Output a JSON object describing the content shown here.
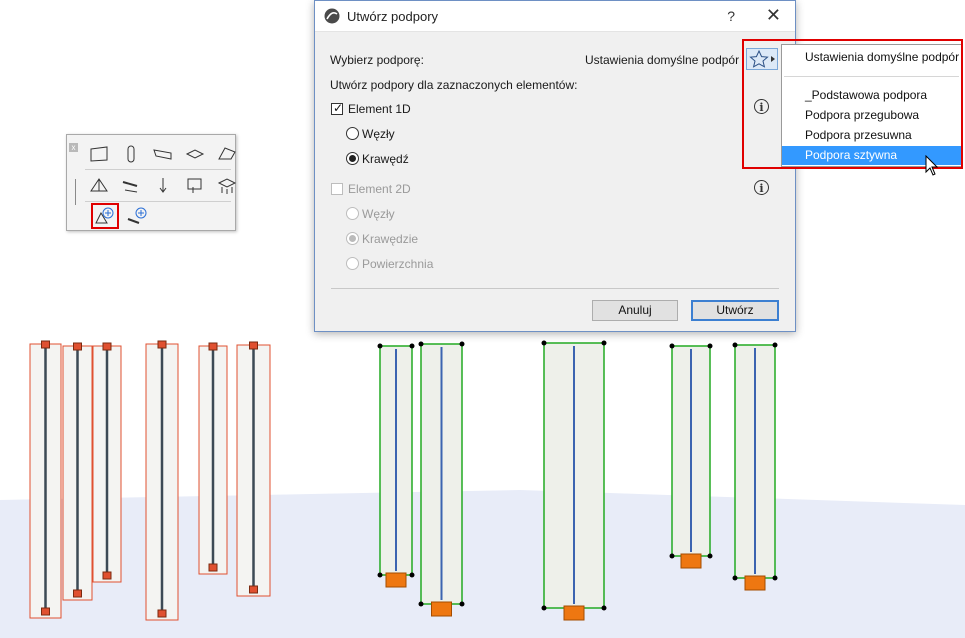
{
  "dialog": {
    "title": "Utwórz podpory",
    "help": "?",
    "close": "✕",
    "select_label": "Wybierz podporę:",
    "select_value": "Ustawienia domyślne podpór",
    "create_for_label": "Utwórz podpory dla zaznaczonych elementów:",
    "element1d": {
      "label": "Element 1D",
      "checked": true
    },
    "element1d_options": [
      {
        "label": "Węzły",
        "selected": false
      },
      {
        "label": "Krawędź",
        "selected": true
      }
    ],
    "element2d": {
      "label": "Element 2D",
      "checked": false
    },
    "element2d_options": [
      {
        "label": "Węzły",
        "selected": false
      },
      {
        "label": "Krawędzie",
        "selected": true
      },
      {
        "label": "Powierzchnia",
        "selected": false
      }
    ],
    "cancel_label": "Anuluj",
    "create_label": "Utwórz"
  },
  "favorites_menu": {
    "items": [
      {
        "label": "Ustawienia domyślne podpór",
        "selected": false
      },
      {
        "label": "_Podstawowa podpora",
        "selected": false
      },
      {
        "label": "Podpora przegubowa",
        "selected": false
      },
      {
        "label": "Podpora przesuwna",
        "selected": false
      },
      {
        "label": "Podpora sztywna",
        "selected": true
      }
    ]
  },
  "icons": {
    "app": "archicad-logo-icon",
    "favorites": "star-icon",
    "info": "info-icon",
    "palette_close": "close-icon"
  },
  "colors": {
    "highlight_frame": "#e00000",
    "menu_selected": "#3399ff",
    "selected_column": "#e05030",
    "unselected_column": "#22aa22",
    "support_block": "#ee7711",
    "floor": "#e8ecf8"
  }
}
